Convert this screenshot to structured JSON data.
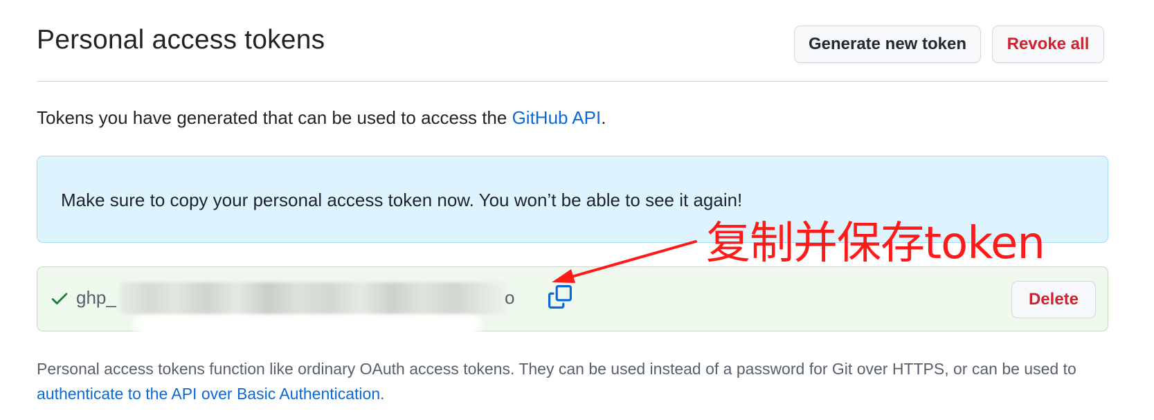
{
  "header": {
    "title": "Personal access tokens",
    "generate_button": "Generate new token",
    "revoke_button": "Revoke all"
  },
  "intro": {
    "text": "Tokens you have generated that can be used to access the ",
    "link": "GitHub API",
    "end": "."
  },
  "flash": {
    "message": "Make sure to copy your personal access token now. You won’t be able to see it again!"
  },
  "token": {
    "prefix": "ghp_",
    "suffix": "o",
    "delete_button": "Delete",
    "status_icon": "check-icon",
    "copy_icon": "copy-icon"
  },
  "footer": {
    "text": "Personal access tokens function like ordinary OAuth access tokens. They can be used instead of a password for Git over HTTPS, or can be used to ",
    "link": "authenticate to the API over Basic Authentication",
    "end": "."
  },
  "annotation": {
    "text": "复制并保存token",
    "color": "#ff1a1a"
  },
  "colors": {
    "link": "#0969da",
    "danger": "#cf222e",
    "success": "#1a7f37",
    "flash_bg": "#ddf4ff",
    "token_bg": "#eff8ec"
  }
}
